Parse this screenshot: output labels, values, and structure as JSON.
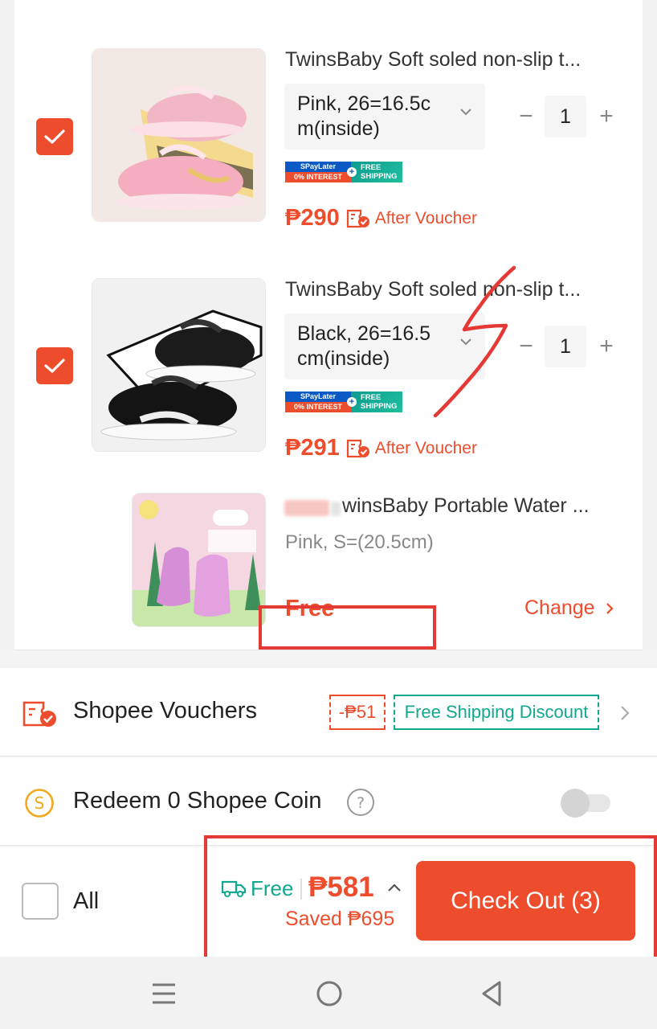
{
  "items": [
    {
      "title": "TwinsBaby Soft soled non-slip t...",
      "variant": "Pink, 26=16.5c m(inside)",
      "quantity": "1",
      "spaylater_top": "SPayLater",
      "spaylater_bottom": "0% INTEREST",
      "free_shipping_top": "FREE",
      "free_shipping_bottom": "SHIPPING",
      "price": "₱290",
      "price_note": "After Voucher",
      "image_icon": "pink-sneakers-image"
    },
    {
      "title": "TwinsBaby Soft soled non-slip t...",
      "variant": "Black, 26=16.5 cm(inside)",
      "quantity": "1",
      "spaylater_top": "SPayLater",
      "spaylater_bottom": "0% INTEREST",
      "free_shipping_top": "FREE",
      "free_shipping_bottom": "SHIPPING",
      "price": "₱291",
      "price_note": "After Voucher",
      "image_icon": "black-sneakers-image"
    }
  ],
  "gift": {
    "title": "winsBaby Portable Water ...",
    "variant": "Pink, S=(20.5cm)",
    "price": "Free",
    "change_label": "Change",
    "image_icon": "pink-shoe-cover-image"
  },
  "vouchers": {
    "label": "Shopee Vouchers",
    "discount_tag": "-₱51",
    "shipping_tag": "Free Shipping Discount"
  },
  "coins": {
    "label": "Redeem 0 Shopee Coin",
    "toggle_on": false
  },
  "footer": {
    "all_label": "All",
    "shipping_label": "Free",
    "total": "₱581",
    "saved": "Saved ₱695",
    "checkout_label": "Check Out (3)"
  },
  "colors": {
    "accent": "#ee4d2d",
    "teal": "#11a88e",
    "annotation_red": "#e53935"
  }
}
